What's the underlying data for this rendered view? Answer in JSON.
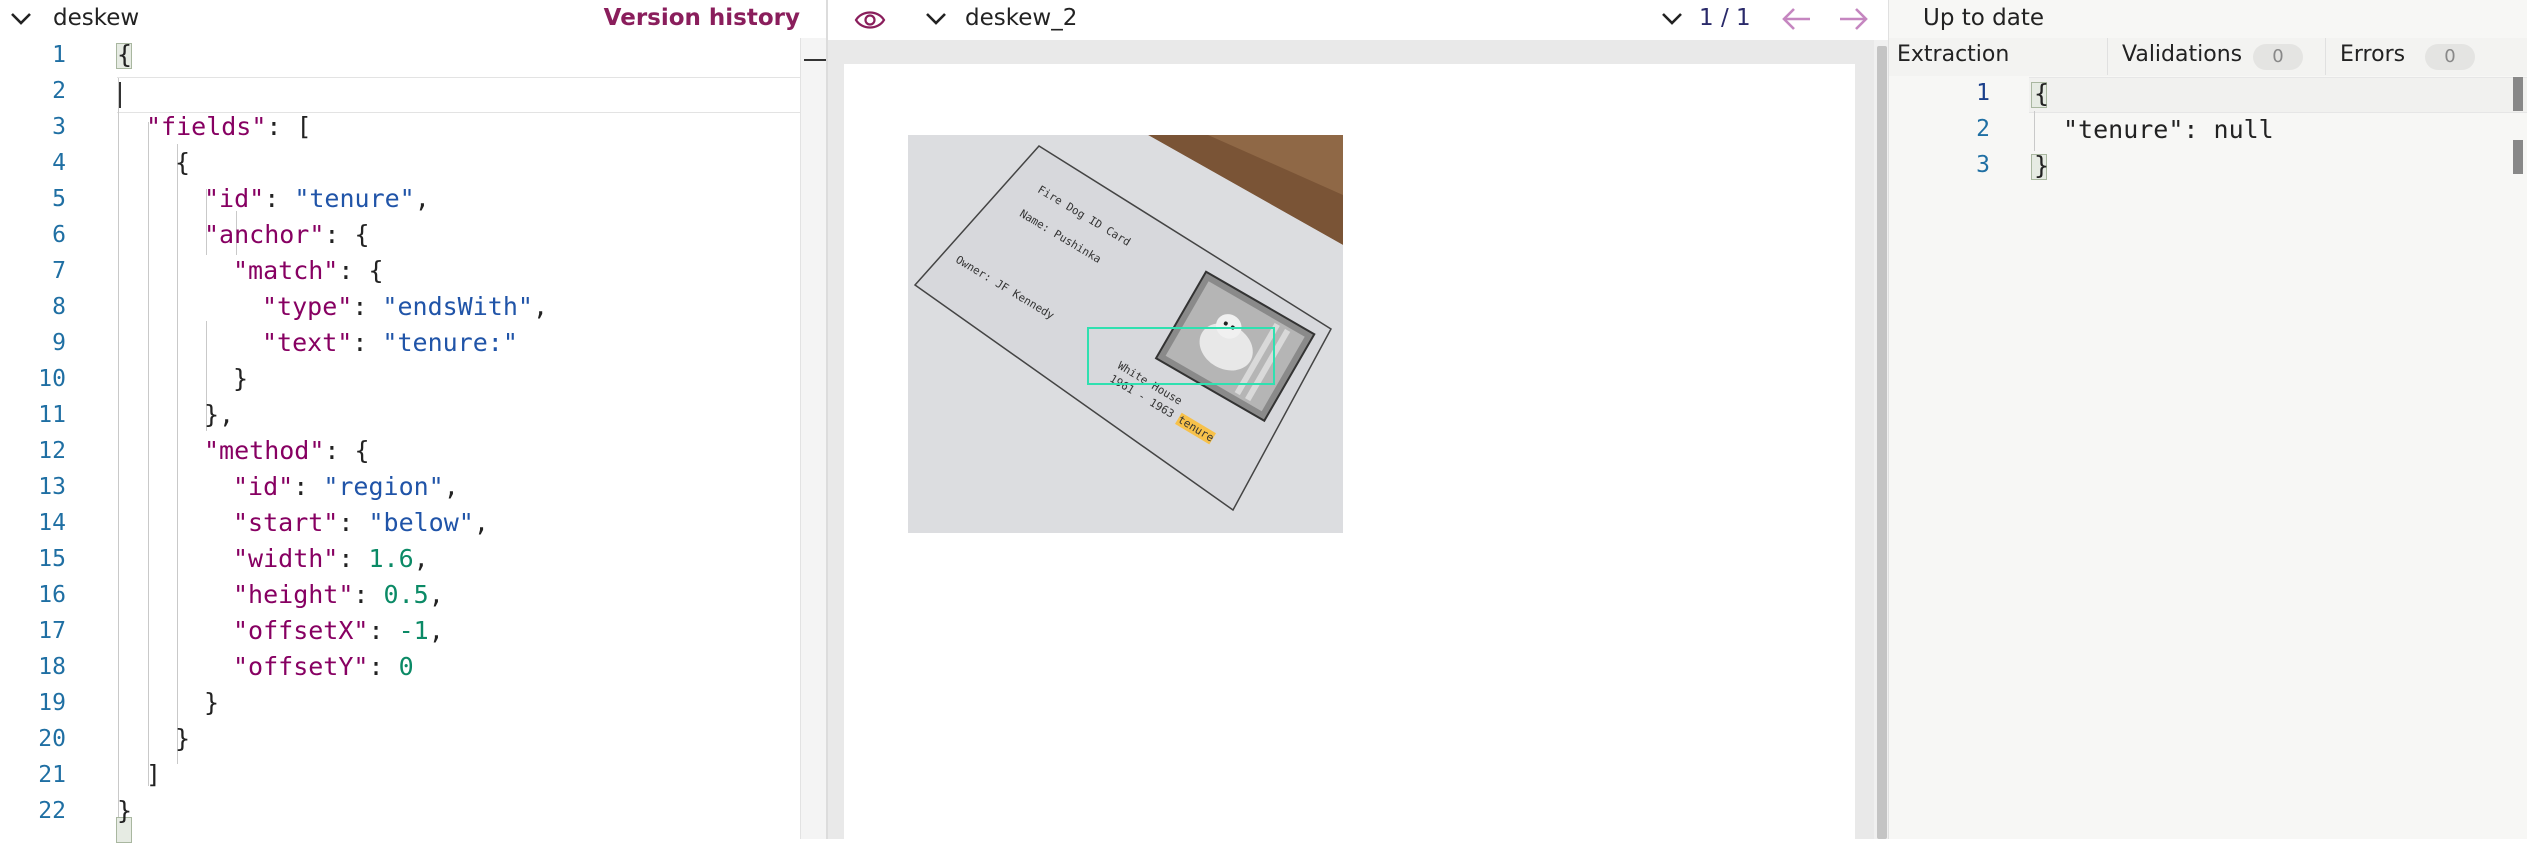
{
  "left": {
    "project_name": "deskew",
    "version_history_label": "Version history",
    "line_numbers": [
      "1",
      "2",
      "3",
      "4",
      "5",
      "6",
      "7",
      "8",
      "9",
      "10",
      "11",
      "12",
      "13",
      "14",
      "15",
      "16",
      "17",
      "18",
      "19",
      "20",
      "21",
      "22"
    ],
    "code": {
      "l1": "{",
      "l3_key": "\"fields\"",
      "l3_rest": ": [",
      "l4": "{",
      "l5_key": "\"id\"",
      "l5_val": "\"tenure\"",
      "l6_key": "\"anchor\"",
      "l7_key": "\"match\"",
      "l8_key": "\"type\"",
      "l8_val": "\"endsWith\"",
      "l9_key": "\"text\"",
      "l9_val": "\"tenure:\"",
      "l10": "}",
      "l11": "},",
      "l12_key": "\"method\"",
      "l13_key": "\"id\"",
      "l13_val": "\"region\"",
      "l14_key": "\"start\"",
      "l14_val": "\"below\"",
      "l15_key": "\"width\"",
      "l15_val": "1.6",
      "l16_key": "\"height\"",
      "l16_val": "0.5",
      "l17_key": "\"offsetX\"",
      "l17_val": "-1",
      "l18_key": "\"offsetY\"",
      "l18_val": "0",
      "l19": "}",
      "l20": "}",
      "l21": "]",
      "l22": "}"
    }
  },
  "middle": {
    "document_name": "deskew_2",
    "page_indicator": "1 / 1",
    "card": {
      "line1": "Fire Dog ID Card",
      "line2": "Name: Pushinka",
      "line3": "Owner: JF Kennedy",
      "line4": "White House",
      "line5a": "1961 - 1963",
      "line5b": "tenure"
    }
  },
  "right": {
    "status": "Up to date",
    "tabs": {
      "extraction": "Extraction",
      "validations": "Validations",
      "validations_count": "0",
      "errors": "Errors",
      "errors_count": "0"
    },
    "line_numbers": [
      "1",
      "2",
      "3"
    ],
    "result": {
      "l1": "{",
      "l2_key": "\"tenure\"",
      "l2_val": "null",
      "l3": "}"
    }
  },
  "colors": {
    "accent": "#8a1e5c",
    "json_key": "#870062",
    "json_string": "#2054a8",
    "json_number": "#0b8a66",
    "line_number": "#1f6fa3",
    "region_box": "#2fe0b0",
    "anchor_highlight": "#f7c14a",
    "nav_arrow": "#c586c0"
  }
}
